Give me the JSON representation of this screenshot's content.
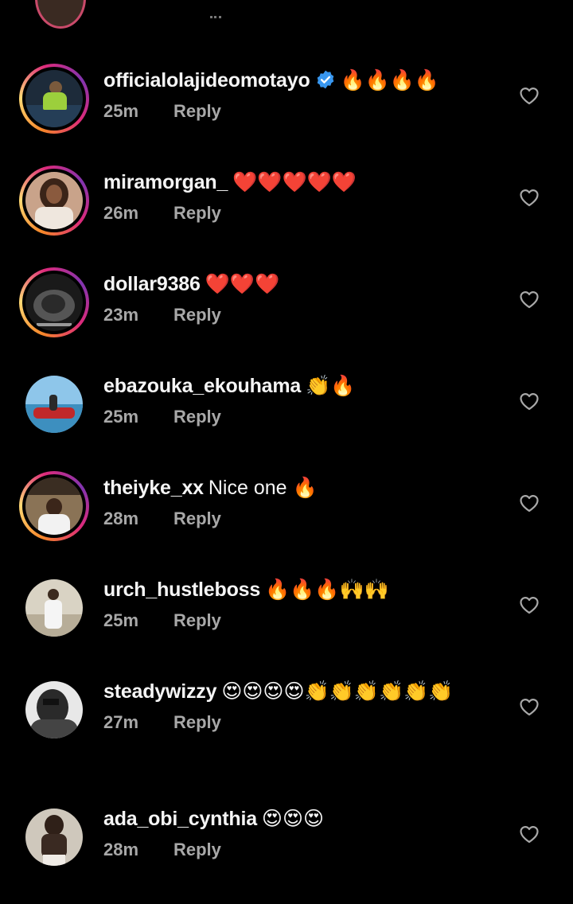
{
  "reply_label": "Reply",
  "icons": {
    "like": "heart-outline-icon",
    "verified": "verified-badge-icon"
  },
  "colors": {
    "background": "#000000",
    "username": "#f5f5f5",
    "meta": "#a8a8a8",
    "verified": "#3897f0"
  },
  "comments": [
    {
      "username": "officialolajideomotayo",
      "verified": true,
      "text": "🔥🔥🔥🔥",
      "time": "25m",
      "story_ring": true
    },
    {
      "username": "miramorgan_",
      "verified": false,
      "text": "❤️❤️❤️❤️❤️",
      "time": "26m",
      "story_ring": true
    },
    {
      "username": "dollar9386",
      "verified": false,
      "text": "❤️❤️❤️",
      "time": "23m",
      "story_ring": true
    },
    {
      "username": "ebazouka_ekouhama",
      "verified": false,
      "text": "👏🔥",
      "time": "25m",
      "story_ring": false
    },
    {
      "username": "theiyke_xx",
      "verified": false,
      "text": "Nice one 🔥",
      "time": "28m",
      "story_ring": true
    },
    {
      "username": "urch_hustleboss",
      "verified": false,
      "text": "🔥🔥🔥🙌🙌",
      "time": "25m",
      "story_ring": false
    },
    {
      "username": "steadywizzy",
      "verified": false,
      "text": "😍😍😍😍👏👏👏👏👏👏",
      "time": "27m",
      "story_ring": false
    },
    {
      "username": "ada_obi_cynthia",
      "verified": false,
      "text": "😍😍😍",
      "time": "28m",
      "story_ring": false
    }
  ]
}
